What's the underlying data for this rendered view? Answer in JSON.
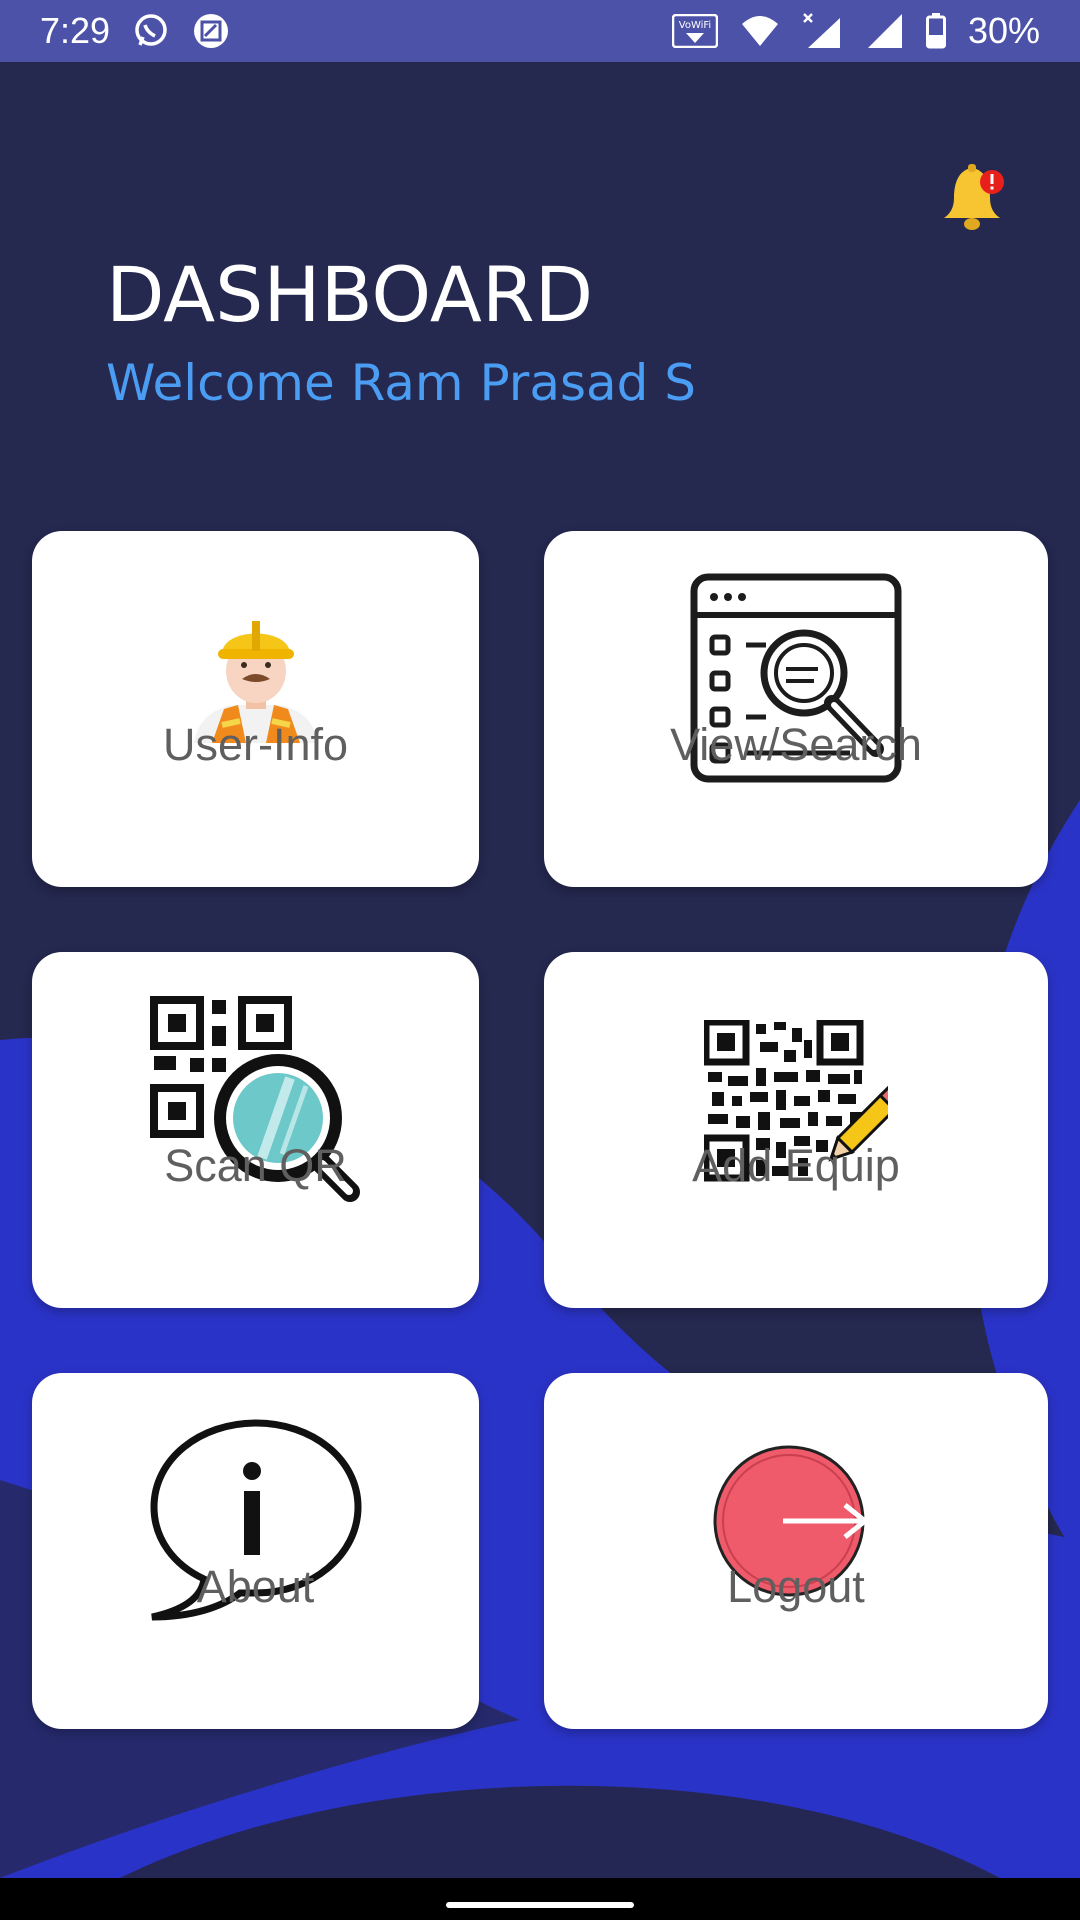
{
  "status_bar": {
    "time": "7:29",
    "battery": "30%",
    "left_icons": [
      "whatsapp-icon",
      "screenshot-icon"
    ],
    "right_icons": [
      "vowifi-icon",
      "wifi-icon",
      "no-signal-icon",
      "signal-icon",
      "battery-icon"
    ]
  },
  "header": {
    "title": "DASHBOARD",
    "welcome": "Welcome Ram Prasad S",
    "notification_icon": "bell-icon"
  },
  "tiles": [
    {
      "label": "User-Info",
      "icon": "worker-avatar-icon"
    },
    {
      "label": "View/Search",
      "icon": "browser-search-icon"
    },
    {
      "label": "Scan QR",
      "icon": "qr-scan-icon"
    },
    {
      "label": "Add Equip",
      "icon": "qr-edit-icon"
    },
    {
      "label": "About",
      "icon": "info-bubble-icon"
    },
    {
      "label": "Logout",
      "icon": "logout-icon"
    }
  ],
  "colors": {
    "background": "#25284f",
    "accent_blue": "#2a33c7",
    "status_bar": "#4c52a8",
    "welcome_text": "#4a9df2",
    "tile_label": "#5f5f5f",
    "logout_red": "#ef5b6b"
  }
}
